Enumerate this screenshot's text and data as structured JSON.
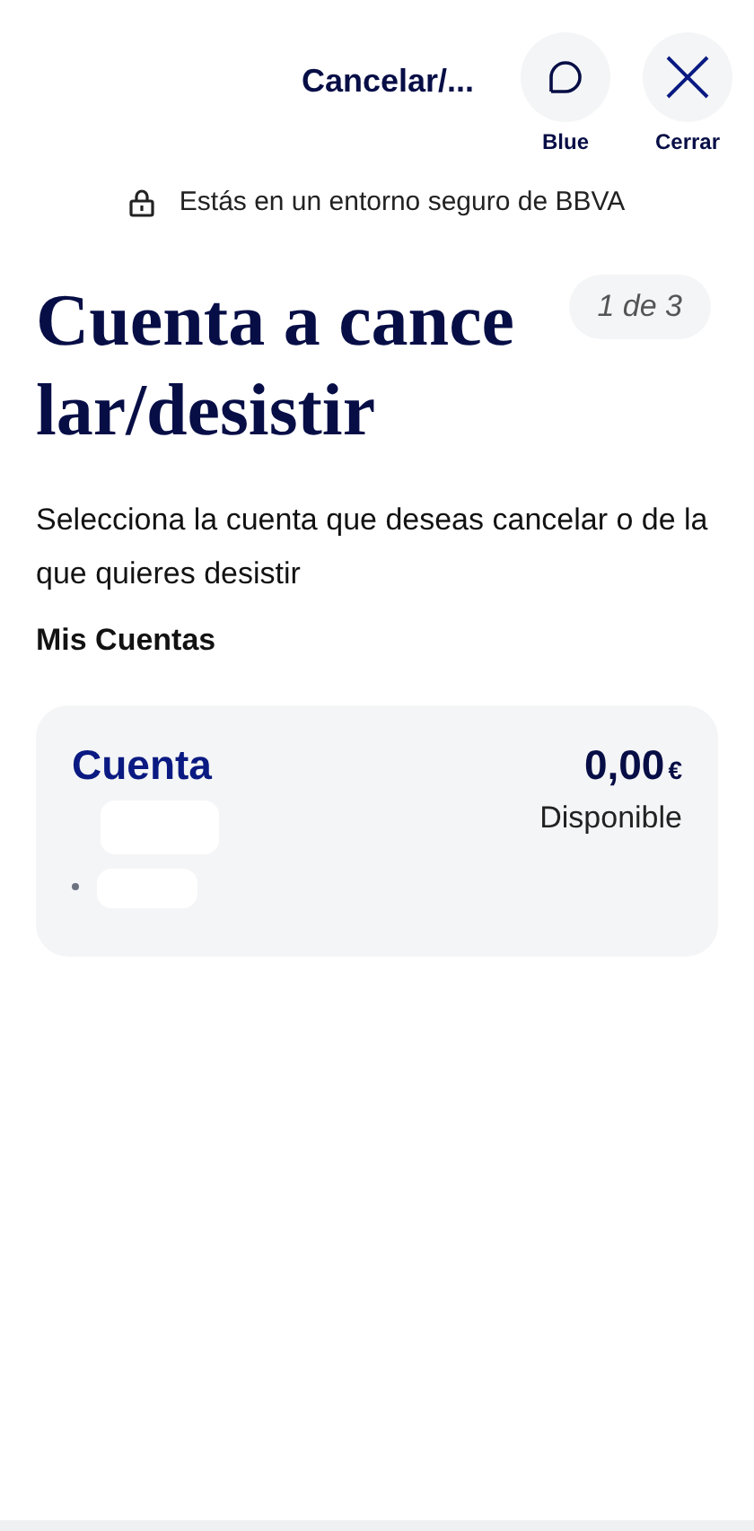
{
  "header": {
    "title": "Cancelar/...",
    "actions": [
      {
        "kind": "chat",
        "label": "Blue"
      },
      {
        "kind": "close",
        "label": "Cerrar"
      }
    ]
  },
  "security_notice": "Estás en un entorno seguro de BBVA",
  "title": "Cuenta a cancelar/desistir",
  "step": "1 de 3",
  "description": "Selecciona la cuenta que deseas cancelar o de la que quieres desistir",
  "section_title": "Mis Cuentas",
  "accounts": [
    {
      "name": "Cuenta",
      "amount": "0,00",
      "currency": "€",
      "balance_label": "Disponible"
    }
  ]
}
